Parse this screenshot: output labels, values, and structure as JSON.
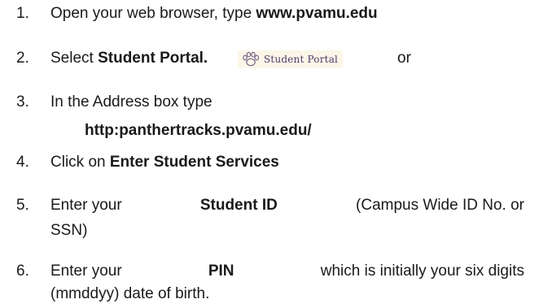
{
  "steps": [
    {
      "number": "1.",
      "text_before": "Open your web browser, type",
      "bold": "www.pvamu.edu"
    },
    {
      "number": "2.",
      "text_before": "Select",
      "bold": "Student Portal.",
      "badge_label": "Student Portal",
      "text_after": "or"
    },
    {
      "number": "3.",
      "text_before": "In the Address box type",
      "bold": "http:panthertracks.pvamu.edu/"
    },
    {
      "number": "4.",
      "text_before": "Click on",
      "bold": "Enter Student Services"
    },
    {
      "number": "5.",
      "text_before": "Enter your",
      "bold": "Student ID",
      "text_after": "(Campus Wide ID No. or",
      "text_after_line2": "SSN)"
    },
    {
      "number": "6.",
      "text_before": "Enter your",
      "bold": "PIN",
      "text_after": "which is initially your six digits",
      "text_after_line2": "(mmddyy) date of birth."
    }
  ],
  "icons": {
    "badge_icon": "paw-print-icon"
  },
  "colors": {
    "text": "#1a1a1a",
    "badge_background": "#fbf6e8",
    "badge_text": "#4d3a6e"
  }
}
